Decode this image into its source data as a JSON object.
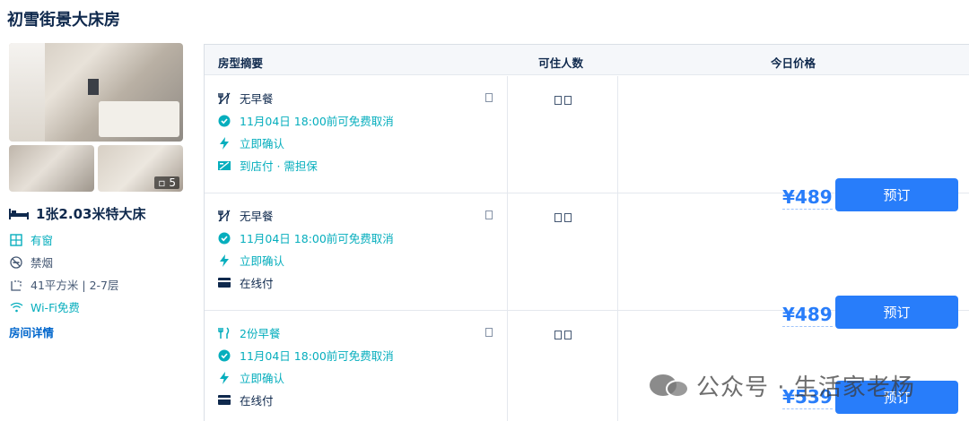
{
  "room": {
    "name": "初雪街景大床房",
    "photo_count": "5",
    "bed": "1张2.03米特大床",
    "amenities": [
      {
        "icon": "window-icon",
        "label": "有窗",
        "color": "#06aebd"
      },
      {
        "icon": "no-smoking-icon",
        "label": "禁烟",
        "color": "#455873"
      },
      {
        "icon": "area-icon",
        "label": "41平方米 | 2-7层",
        "color": "#455873"
      },
      {
        "icon": "wifi-icon",
        "label": "Wi-Fi免费",
        "color": "#06aebd"
      }
    ],
    "details_link": "房间详情"
  },
  "table": {
    "headers": {
      "summary": "房型摘要",
      "occupancy": "可住人数",
      "price": "今日价格"
    },
    "occupancy_glyph": "□□",
    "rows": [
      {
        "features": [
          {
            "icon": "cutlery-crossed-icon",
            "text": "无早餐",
            "color": "#0f294d"
          },
          {
            "icon": "check-circle-icon",
            "text": "11月04日 18:00前可免费取消",
            "color": "#06aebd"
          },
          {
            "icon": "lightning-icon",
            "text": "立即确认",
            "color": "#06aebd"
          },
          {
            "icon": "pay-at-hotel-icon",
            "text": "到店付 · 需担保",
            "color": "#06aebd"
          }
        ],
        "price": "¥489",
        "button": "预订"
      },
      {
        "features": [
          {
            "icon": "cutlery-crossed-icon",
            "text": "无早餐",
            "color": "#0f294d"
          },
          {
            "icon": "check-circle-icon",
            "text": "11月04日 18:00前可免费取消",
            "color": "#06aebd"
          },
          {
            "icon": "lightning-icon",
            "text": "立即确认",
            "color": "#06aebd"
          },
          {
            "icon": "card-icon",
            "text": "在线付",
            "color": "#0f294d"
          }
        ],
        "price": "¥489",
        "button": "预订"
      },
      {
        "features": [
          {
            "icon": "cutlery-icon",
            "text": "2份早餐",
            "color": "#06aebd"
          },
          {
            "icon": "check-circle-icon",
            "text": "11月04日 18:00前可免费取消",
            "color": "#06aebd"
          },
          {
            "icon": "lightning-icon",
            "text": "立即确认",
            "color": "#06aebd"
          },
          {
            "icon": "card-icon",
            "text": "在线付",
            "color": "#0f294d"
          }
        ],
        "price": "¥539",
        "button": "预订"
      }
    ]
  },
  "watermark": "公众号 · 生活家老杨",
  "colors": {
    "accent": "#287dfa",
    "teal": "#06aebd",
    "text": "#0f294d"
  }
}
